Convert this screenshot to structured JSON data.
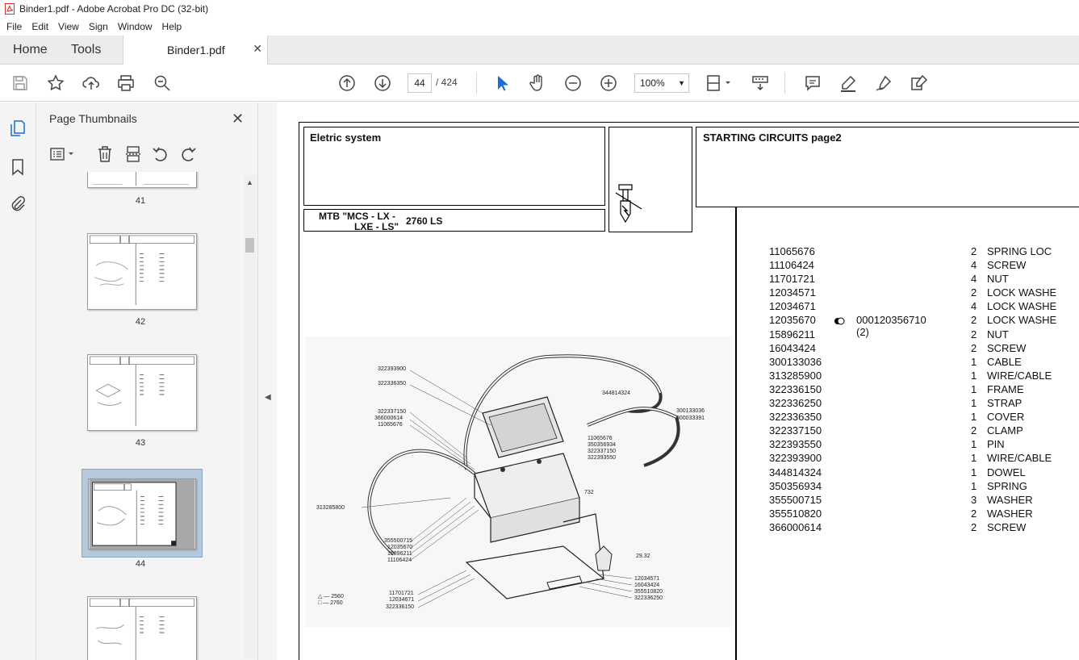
{
  "window": {
    "title": "Binder1.pdf - Adobe Acrobat Pro DC (32-bit)"
  },
  "menu": [
    "File",
    "Edit",
    "View",
    "Sign",
    "Window",
    "Help"
  ],
  "tabs": {
    "home": "Home",
    "tools": "Tools",
    "document": "Binder1.pdf"
  },
  "toolbar": {
    "page_current": "44",
    "page_total": "/ 424",
    "zoom": "100%"
  },
  "panel": {
    "title": "Page Thumbnails",
    "thumbnails": [
      {
        "num": "41"
      },
      {
        "num": "42"
      },
      {
        "num": "43"
      },
      {
        "num": "44",
        "selected": true
      },
      {
        "num": ""
      }
    ]
  },
  "pdf": {
    "section": "Eletric system",
    "heading": "STARTING CIRCUITS  page2",
    "model_line1": "MTB \"MCS - LX -",
    "model_line2": "LXE - LS\"",
    "model_num": "2760  LS",
    "parts": [
      {
        "pn": "11065676",
        "extra": "",
        "qty": "2",
        "desc": "SPRING LOC"
      },
      {
        "pn": "11106424",
        "extra": "",
        "qty": "4",
        "desc": "SCREW"
      },
      {
        "pn": "11701721",
        "extra": "",
        "qty": "4",
        "desc": "NUT"
      },
      {
        "pn": "12034571",
        "extra": "",
        "qty": "2",
        "desc": "LOCK WASHE"
      },
      {
        "pn": "12034671",
        "extra": "",
        "qty": "4",
        "desc": "LOCK WASHE"
      },
      {
        "pn": "12035670",
        "extra": "000120356710  (2)",
        "qty": "2",
        "desc": "LOCK WASHE"
      },
      {
        "pn": "15896211",
        "extra": "",
        "qty": "2",
        "desc": "NUT"
      },
      {
        "pn": "16043424",
        "extra": "",
        "qty": "2",
        "desc": "SCREW"
      },
      {
        "pn": "300133036",
        "extra": "",
        "qty": "1",
        "desc": "CABLE"
      },
      {
        "pn": "313285900",
        "extra": "",
        "qty": "1",
        "desc": "WIRE/CABLE"
      },
      {
        "pn": "322336150",
        "extra": "",
        "qty": "1",
        "desc": "FRAME"
      },
      {
        "pn": "322336250",
        "extra": "",
        "qty": "1",
        "desc": "STRAP"
      },
      {
        "pn": "322336350",
        "extra": "",
        "qty": "1",
        "desc": "COVER"
      },
      {
        "pn": "322337150",
        "extra": "",
        "qty": "2",
        "desc": "CLAMP"
      },
      {
        "pn": "322393550",
        "extra": "",
        "qty": "1",
        "desc": "PIN"
      },
      {
        "pn": "322393900",
        "extra": "",
        "qty": "1",
        "desc": "WIRE/CABLE"
      },
      {
        "pn": "344814324",
        "extra": "",
        "qty": "1",
        "desc": "DOWEL"
      },
      {
        "pn": "350356934",
        "extra": "",
        "qty": "1",
        "desc": "SPRING"
      },
      {
        "pn": "355500715",
        "extra": "",
        "qty": "3",
        "desc": "WASHER"
      },
      {
        "pn": "355510820",
        "extra": "",
        "qty": "2",
        "desc": "WASHER"
      },
      {
        "pn": "366000614",
        "extra": "",
        "qty": "2",
        "desc": "SCREW"
      }
    ],
    "diagram_labels": {
      "l1": "322393900",
      "l2": "322336350",
      "l3": "322337150",
      "l4": "366000614",
      "l5": "11065676",
      "l6": "313285800",
      "l7": "355500715",
      "l8": "12035670",
      "l9": "15896211",
      "l10": "11106424",
      "l11": "11701721",
      "l12": "12034671",
      "l13": "322336150",
      "l14": "344814324",
      "l15": "11065676",
      "l16": "350356934",
      "l17": "322337150",
      "l18": "322393550",
      "l19": "300133036",
      "l20": "300033391",
      "l21": "732",
      "l22": "29.32",
      "l23": "12034571",
      "l24": "16043424",
      "l25": "355510820",
      "l26": "322336250",
      "l27": "△ — 2560",
      "l28": "□ — 2760"
    }
  }
}
